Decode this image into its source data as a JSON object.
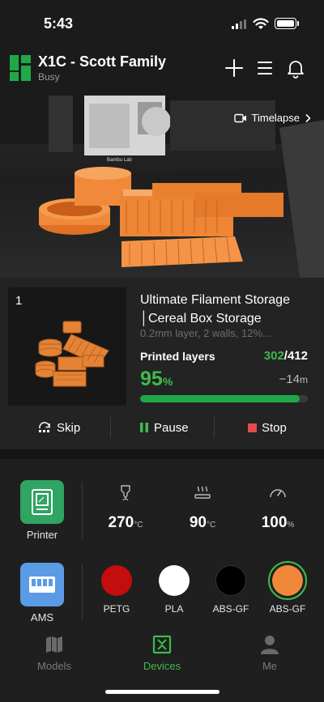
{
  "status_bar": {
    "time": "5:43"
  },
  "header": {
    "printer_name": "X1C - Scott Family",
    "status": "Busy"
  },
  "camera": {
    "timelapse_label": "Timelapse",
    "printer_brand_text": "Bambu Lab"
  },
  "job": {
    "plate_number": "1",
    "title": "Ultimate Filament Storage\n│Cereal Box Storage",
    "title_line1": "Ultimate Filament Storage",
    "title_line2": "│Cereal Box Storage",
    "description": "0.2mm layer, 2 walls, 12%...",
    "layers_label": "Printed layers",
    "layers_current": "302",
    "layers_total": "/412",
    "percent_value": "95",
    "percent_unit": "%",
    "progress": 0.95,
    "remaining_value": "−14",
    "remaining_unit": "m",
    "actions": {
      "skip": "Skip",
      "pause": "Pause",
      "stop": "Stop"
    }
  },
  "controls": {
    "printer_label": "Printer",
    "ams_label": "AMS",
    "nozzle_temp": {
      "value": "270",
      "unit": "°C"
    },
    "bed_temp": {
      "value": "90",
      "unit": "°C"
    },
    "speed": {
      "value": "100",
      "unit": "%"
    }
  },
  "ams_slots": [
    {
      "label": "PETG",
      "color": "#c40d0d"
    },
    {
      "label": "PLA",
      "color": "#ffffff"
    },
    {
      "label": "ABS-GF",
      "color": "#000000"
    },
    {
      "label": "ABS-GF",
      "color": "#f0883a"
    }
  ],
  "nav": {
    "models": "Models",
    "devices": "Devices",
    "me": "Me"
  },
  "colors": {
    "accent_green": "#3dbb4d",
    "progress_green": "#1fa84a",
    "stop_red": "#e64a4a",
    "filament_orange": "#f0883a"
  }
}
